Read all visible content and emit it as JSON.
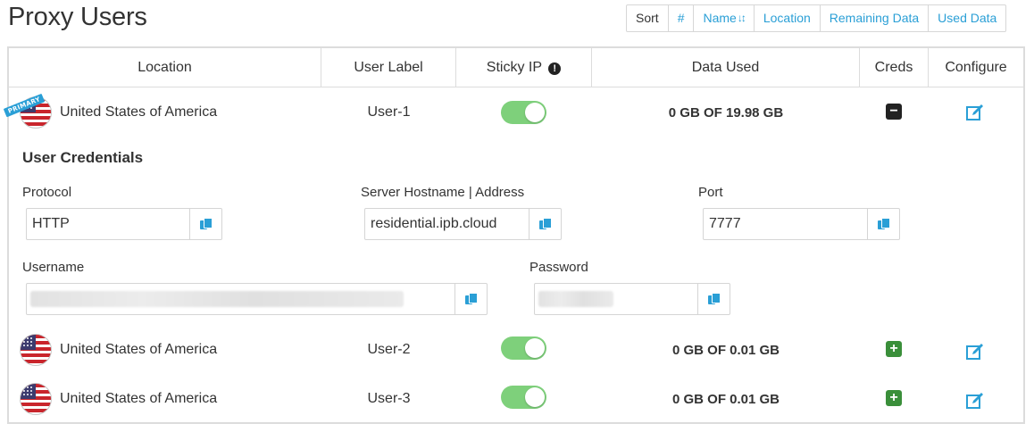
{
  "page": {
    "title": "Proxy Users"
  },
  "sort_bar": {
    "sort_label": "Sort",
    "hash_label": "#",
    "name_label": "Name",
    "name_arrows": "↓↕",
    "location_label": "Location",
    "remaining_label": "Remaining Data",
    "used_label": "Used Data"
  },
  "table": {
    "headers": {
      "location": "Location",
      "user_label": "User Label",
      "sticky_ip": "Sticky IP",
      "sticky_info": "!",
      "data_used": "Data Used",
      "creds": "Creds",
      "configure": "Configure"
    },
    "rows": [
      {
        "location": "United States of America",
        "label": "User-1",
        "sticky_ip": true,
        "data_used": "0 GB OF 19.98 GB",
        "creds_expanded": true,
        "badge": "PRIMARY",
        "creds_symbol": "−"
      },
      {
        "location": "United States of America",
        "label": "User-2",
        "sticky_ip": true,
        "data_used": "0 GB OF 0.01 GB",
        "creds_expanded": false,
        "creds_symbol": "+"
      },
      {
        "location": "United States of America",
        "label": "User-3",
        "sticky_ip": true,
        "data_used": "0 GB OF 0.01 GB",
        "creds_expanded": false,
        "creds_symbol": "+"
      }
    ]
  },
  "credentials": {
    "title": "User Credentials",
    "protocol_label": "Protocol",
    "protocol_value": "HTTP",
    "hostname_label": "Server Hostname | Address",
    "hostname_value": "residential.ipb.cloud",
    "port_label": "Port",
    "port_value": "7777",
    "username_label": "Username",
    "password_label": "Password"
  },
  "colors": {
    "link_blue": "#2a9fd6",
    "toggle_green": "#7ed07b",
    "plus_green": "#3a8f3a",
    "minus_dark": "#222222"
  }
}
